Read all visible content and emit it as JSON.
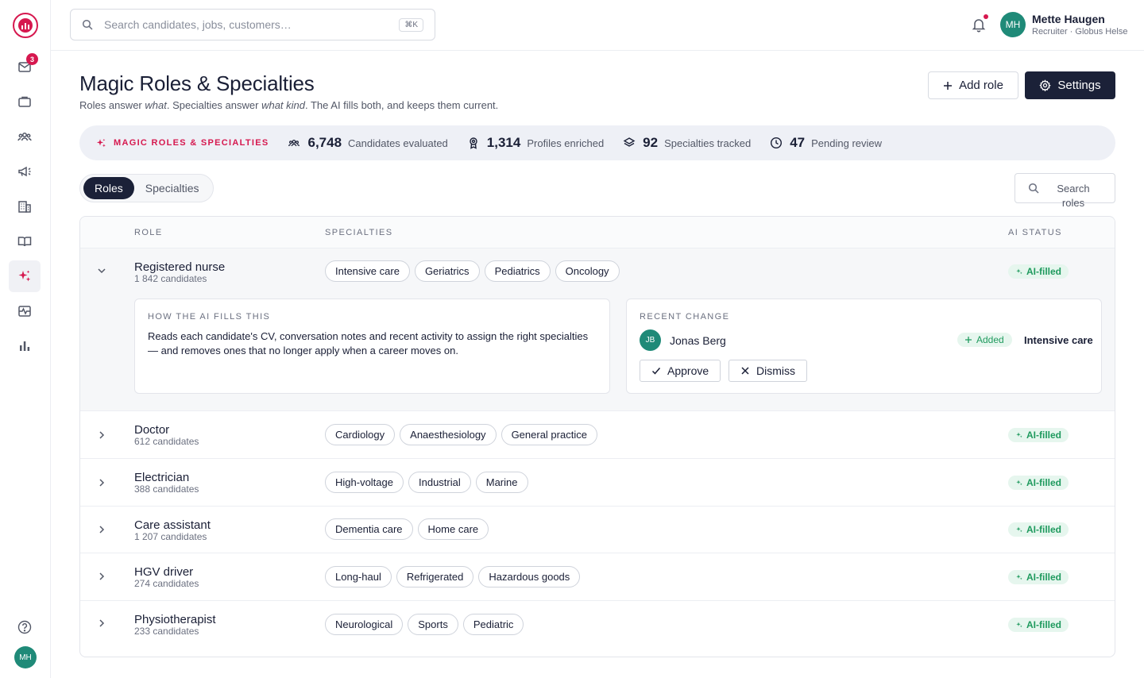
{
  "topbar": {
    "search_placeholder": "Search candidates, jobs, customers…",
    "search_shortcut": "⌘K",
    "user": {
      "initials": "MH",
      "name": "Mette Haugen",
      "role": "Recruiter · Globus Helse"
    }
  },
  "sidebar": {
    "inbox_badge": "3",
    "avatar_initials": "MH",
    "items": [
      "inbox-icon",
      "briefcase-icon",
      "people-icon",
      "megaphone-icon",
      "building-icon",
      "book-icon",
      "sparkle-icon",
      "pulse-icon",
      "bar-chart-icon",
      "help-icon"
    ],
    "active_item": "sparkle-icon"
  },
  "header": {
    "title": "Magic Roles & Specialties",
    "subtitle_a": "Roles answer ",
    "subtitle_b": "what",
    "subtitle_c": ". Specialties answer ",
    "subtitle_d": "what kind",
    "subtitle_e": ". The AI fills both, and keeps them current.",
    "add_role_label": "Add role",
    "settings_label": "Settings"
  },
  "stats": {
    "brand": "MAGIC ROLES & SPECIALTIES",
    "items": [
      {
        "icon": "people-icon",
        "value": "6,748",
        "label": "Candidates evaluated"
      },
      {
        "icon": "award-icon",
        "value": "1,314",
        "label": "Profiles enriched"
      },
      {
        "icon": "layers-icon",
        "value": "92",
        "label": "Specialties tracked"
      },
      {
        "icon": "clock-icon",
        "value": "47",
        "label": "Pending review"
      }
    ]
  },
  "tabs": {
    "roles": "Roles",
    "specialties": "Specialties",
    "active": "roles"
  },
  "search_roles": {
    "placeholder": "Search roles"
  },
  "table": {
    "headers": {
      "role": "ROLE",
      "specialties": "SPECIALTIES",
      "status": "AI STATUS"
    },
    "rows": [
      {
        "name": "Registered nurse",
        "count": "1 842 candidates",
        "specialties": [
          "Intensive care",
          "Geriatrics",
          "Pediatrics",
          "Oncology"
        ],
        "status": "AI-filled",
        "expanded": true
      },
      {
        "name": "Doctor",
        "count": "612 candidates",
        "specialties": [
          "Cardiology",
          "Anaesthesiology",
          "General practice"
        ],
        "status": "AI-filled"
      },
      {
        "name": "Electrician",
        "count": "388 candidates",
        "specialties": [
          "High-voltage",
          "Industrial",
          "Marine"
        ],
        "status": "AI-filled"
      },
      {
        "name": "Care assistant",
        "count": "1 207 candidates",
        "specialties": [
          "Dementia care",
          "Home care"
        ],
        "status": "AI-filled"
      },
      {
        "name": "HGV driver",
        "count": "274 candidates",
        "specialties": [
          "Long-haul",
          "Refrigerated",
          "Hazardous goods"
        ],
        "status": "AI-filled"
      },
      {
        "name": "Physiotherapist",
        "count": "233 candidates",
        "specialties": [
          "Neurological",
          "Sports",
          "Pediatric"
        ],
        "status": "AI-filled"
      }
    ],
    "detail": {
      "how_heading": "HOW THE AI FILLS THIS",
      "how_text": "Reads each candidate's CV, conversation notes and recent activity to assign the right specialties — and removes ones that no longer apply when a career moves on.",
      "recent_heading": "RECENT CHANGE",
      "person_initials": "JB",
      "person_name": "Jonas Berg",
      "change_type": "Added",
      "change_value": "Intensive care",
      "approve_label": "Approve",
      "dismiss_label": "Dismiss"
    }
  },
  "colors": {
    "brand": "#d6184f",
    "dark": "#1b2138",
    "ai_green": "#1f9a5e",
    "avatar_teal": "#1f8a78"
  }
}
